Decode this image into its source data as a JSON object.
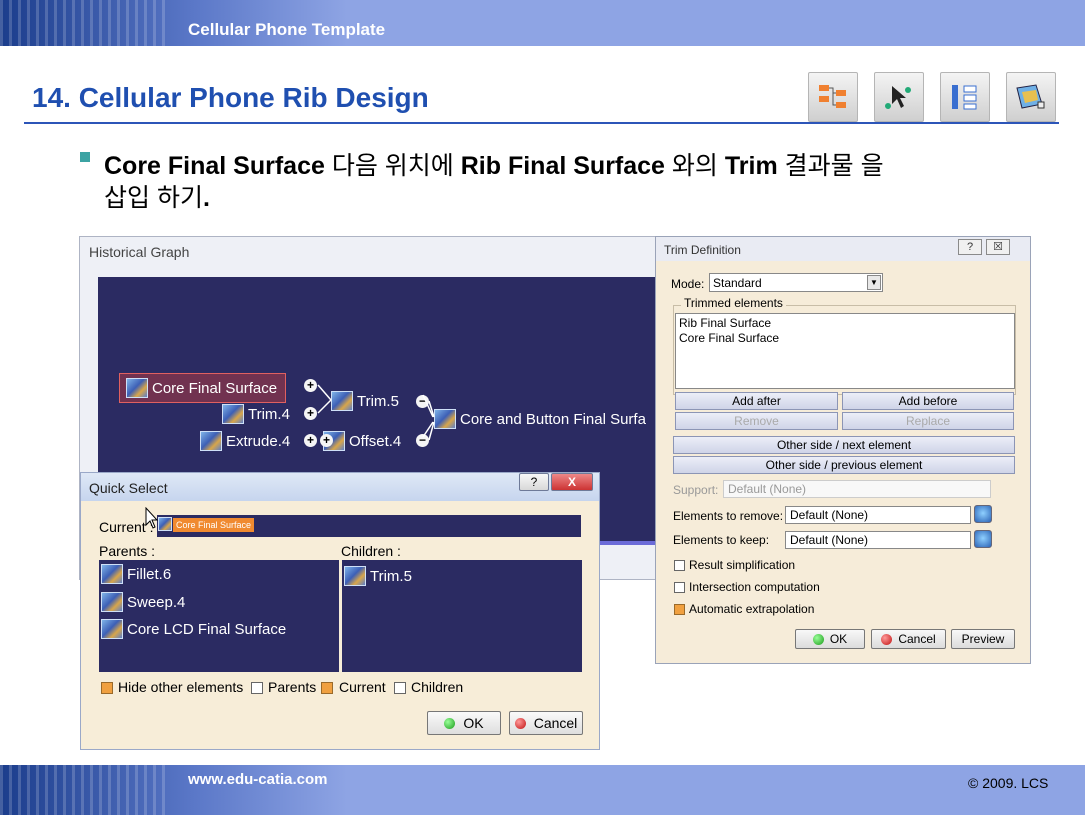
{
  "header": {
    "title": "Cellular Phone Template"
  },
  "footer": {
    "url": "www.edu-catia.com",
    "copyright": "© 2009. LCS"
  },
  "slide": {
    "title": "14. Cellular Phone Rib Design",
    "bullet": {
      "part1": "Core Final Surface",
      "part2": " 다음 위치에 ",
      "part3": "Rib Final Surface",
      "part4": " 와의 ",
      "part5": "Trim",
      "part6": " 결과물 을",
      "line2": "삽입 하기",
      "line2_end": "."
    }
  },
  "toolbar": {
    "icons": [
      "insert-tree-icon",
      "select-cursor-icon",
      "hierarchy-icon",
      "surface-icon"
    ]
  },
  "historical_graph": {
    "title": "Historical Graph",
    "nodes": {
      "core": "Core Final Surface",
      "trim4": "Trim.4",
      "extrude4": "Extrude.4",
      "trim5": "Trim.5",
      "offset4": "Offset.4",
      "result": "Core and Button Final Surfa"
    }
  },
  "trim_definition": {
    "title": "Trim Definition",
    "help": "?",
    "close": "☒",
    "mode_label": "Mode:",
    "mode_value": "Standard",
    "trimmed_label": "Trimmed elements",
    "trimmed_items": [
      "Rib Final Surface",
      "Core Final Surface"
    ],
    "add_after": "Add after",
    "add_before": "Add before",
    "remove": "Remove",
    "replace": "Replace",
    "other_next": "Other side / next element",
    "other_prev": "Other side / previous element",
    "support_label": "Support:",
    "support_value": "Default (None)",
    "remove_label": "Elements to remove:",
    "remove_value": "Default (None)",
    "keep_label": "Elements to keep:",
    "keep_value": "Default (None)",
    "opt_result": "Result simplification",
    "opt_intersection": "Intersection computation",
    "opt_extrap": "Automatic extrapolation",
    "ok": "OK",
    "cancel": "Cancel",
    "preview": "Preview"
  },
  "quick_select": {
    "title": "Quick Select",
    "help": "?",
    "close": "X",
    "current_label": "Current :",
    "current_value": "Core Final Surface",
    "parents_label": "Parents :",
    "children_label": "Children :",
    "parents": [
      "Fillet.6",
      "Sweep.4",
      "Core LCD Final Surface"
    ],
    "children": [
      "Trim.5"
    ],
    "hide_other": "Hide other elements",
    "chk_parents": "Parents",
    "chk_current": "Current",
    "chk_children": "Children",
    "ok": "OK",
    "cancel": "Cancel"
  }
}
